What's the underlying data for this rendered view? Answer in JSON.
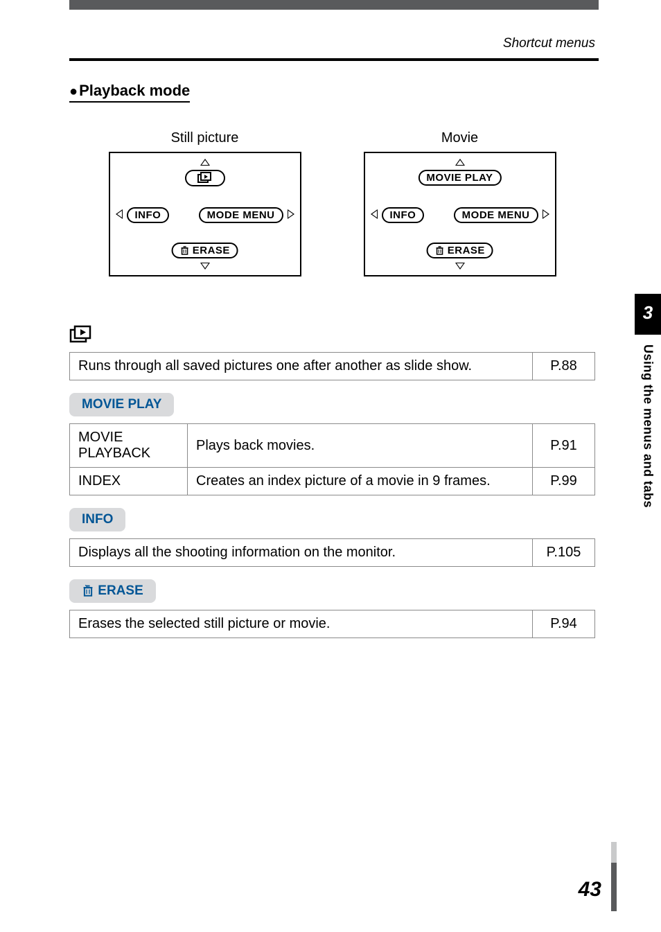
{
  "header": {
    "breadcrumb": "Shortcut menus",
    "section_title": "Playback mode"
  },
  "diagrams": {
    "still": {
      "title": "Still picture",
      "top_icon": "slideshow-icon",
      "left": "INFO",
      "right": "MODE MENU",
      "bottom": "ERASE"
    },
    "movie": {
      "title": "Movie",
      "top": "MOVIE PLAY",
      "left": "INFO",
      "right": "MODE MENU",
      "bottom": "ERASE"
    }
  },
  "slideshow": {
    "desc": "Runs through all saved pictures one after another as slide show.",
    "page": "P.88"
  },
  "movie_play": {
    "label": "MOVIE PLAY",
    "rows": [
      {
        "key": "MOVIE PLAYBACK",
        "desc": "Plays back movies.",
        "page": "P.91"
      },
      {
        "key": "INDEX",
        "desc": "Creates an index picture of a movie in 9 frames.",
        "page": "P.99"
      }
    ]
  },
  "info": {
    "label": "INFO",
    "desc": "Displays all the shooting information on the monitor.",
    "page": "P.105"
  },
  "erase": {
    "label": "ERASE",
    "desc": "Erases the selected still picture or movie.",
    "page": "P.94"
  },
  "side": {
    "chapter": "3",
    "title": "Using the menus and tabs"
  },
  "page_number": "43"
}
